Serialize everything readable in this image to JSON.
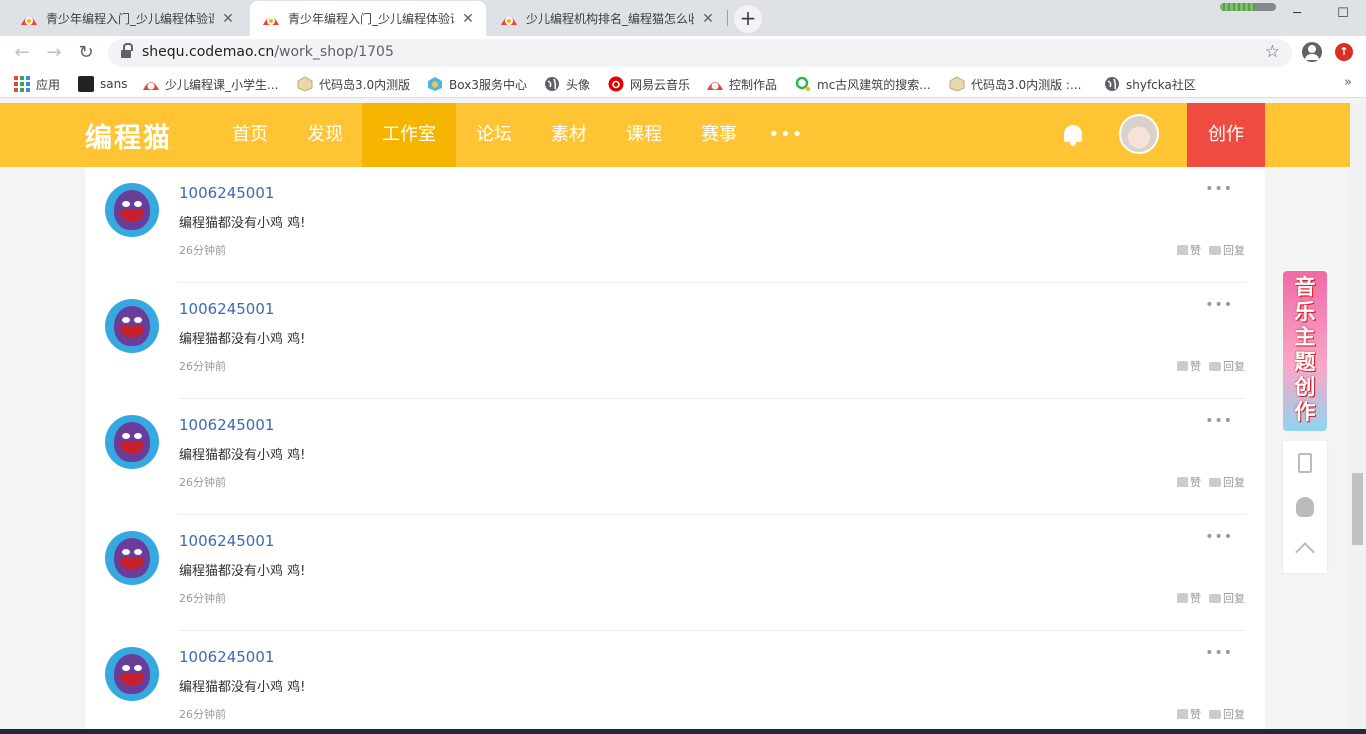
{
  "browser": {
    "tabs": [
      {
        "title": "青少年编程入门_少儿编程体验课",
        "active": false
      },
      {
        "title": "青少年编程入门_少儿编程体验课",
        "active": true
      },
      {
        "title": "少儿编程机构排名_编程猫怎么收",
        "active": false
      }
    ],
    "close_glyph": "✕",
    "new_tab_glyph": "+",
    "download_progress": 0.62,
    "url_host": "shequ.codemao.cn",
    "url_path": "/work_shop/1705",
    "bookmarks": [
      {
        "label": "应用",
        "icon": "apps-grid-icon"
      },
      {
        "label": "sans",
        "icon": "sans-icon"
      },
      {
        "label": "少儿编程课_小学生...",
        "icon": "codemao-icon"
      },
      {
        "label": "代码岛3.0内测版",
        "icon": "cube-icon"
      },
      {
        "label": "Box3服务中心",
        "icon": "box3-icon"
      },
      {
        "label": "头像",
        "icon": "globe-icon"
      },
      {
        "label": "网易云音乐",
        "icon": "netease-music-icon"
      },
      {
        "label": "控制作品",
        "icon": "codemao-icon"
      },
      {
        "label": "mc古风建筑的搜索...",
        "icon": "search-green-icon"
      },
      {
        "label": "代码岛3.0内测版 :...",
        "icon": "cube-icon"
      },
      {
        "label": "shyfcka社区",
        "icon": "globe-icon"
      }
    ],
    "bookmarks_more": "»"
  },
  "site": {
    "logo": "编程猫",
    "nav": [
      {
        "label": "首页",
        "active": false
      },
      {
        "label": "发现",
        "active": false
      },
      {
        "label": "工作室",
        "active": true
      },
      {
        "label": "论坛",
        "active": false
      },
      {
        "label": "素材",
        "active": false
      },
      {
        "label": "课程",
        "active": false
      },
      {
        "label": "赛事",
        "active": false
      }
    ],
    "nav_more": "•••",
    "create_label": "创作"
  },
  "comments": [
    {
      "user": "1006245001",
      "text": "编程猫都没有小鸡 鸡!",
      "time": "26分钟前",
      "like_label": "赞",
      "reply_label": "回复",
      "more": "•••"
    },
    {
      "user": "1006245001",
      "text": "编程猫都没有小鸡 鸡!",
      "time": "26分钟前",
      "like_label": "赞",
      "reply_label": "回复",
      "more": "•••"
    },
    {
      "user": "1006245001",
      "text": "编程猫都没有小鸡 鸡!",
      "time": "26分钟前",
      "like_label": "赞",
      "reply_label": "回复",
      "more": "•••"
    },
    {
      "user": "1006245001",
      "text": "编程猫都没有小鸡 鸡!",
      "time": "26分钟前",
      "like_label": "赞",
      "reply_label": "回复",
      "more": "•••"
    },
    {
      "user": "1006245001",
      "text": "编程猫都没有小鸡 鸡!",
      "time": "26分钟前",
      "like_label": "赞",
      "reply_label": "回复",
      "more": "•••"
    }
  ],
  "promo_banner": "音乐主题创作",
  "colors": {
    "header": "#fec433",
    "header_active": "#f5b400",
    "create_button": "#ef4b40",
    "username": "#3a6bb4"
  }
}
